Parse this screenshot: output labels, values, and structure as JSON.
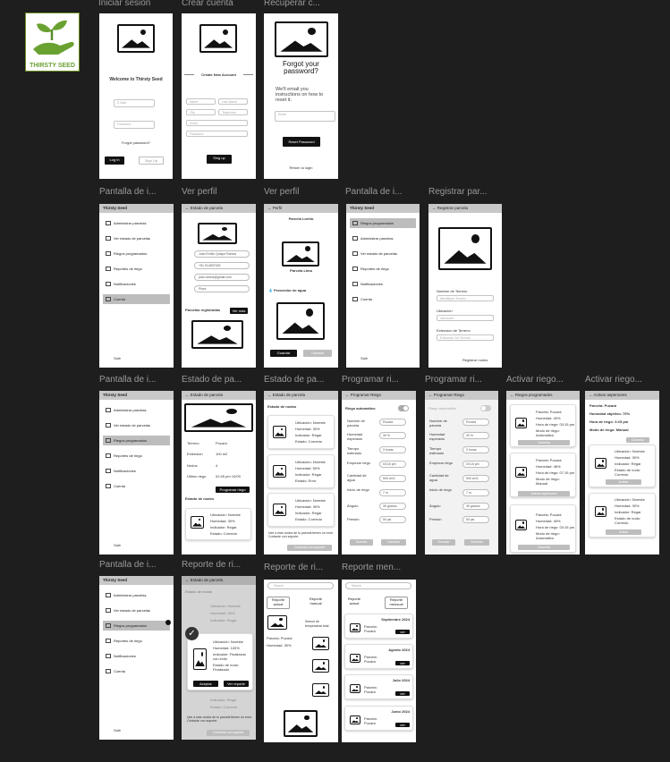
{
  "logo": {
    "text": "THIRSTY SEED"
  },
  "labels": {
    "l1": "Iniciar sesion",
    "l2": "Crear cuenta",
    "l3": "Recuperar c...",
    "l4": "Pantalla de i...",
    "l5": "Ver perfil",
    "l6": "Ver perfil",
    "l7": "Pantalla de i...",
    "l8": "Registrar par...",
    "l9": "Pantalla de i...",
    "l10": "Estado de pa...",
    "l11": "Estado de pa...",
    "l12": "Programar ri...",
    "l13": "Programar ri...",
    "l14": "Activar riego...",
    "l15": "Activar riego...",
    "l16": "Pantalla de i...",
    "l17": "Reporte de ri...",
    "l18": "Reporte de ri...",
    "l19": "Reporte men..."
  },
  "login": {
    "welcome": "Welcome to Thirsty Seed",
    "email": "E-Mail",
    "password": "Password",
    "forgot": "Forgot password?",
    "login": "Log In",
    "signup": "Sign Up"
  },
  "create": {
    "title": "Create New Account",
    "name": "Name",
    "last": "Last Name",
    "city": "City",
    "phone": "Telephone",
    "email": "Email",
    "password": "Password",
    "signup": "Sing up"
  },
  "recover": {
    "title": "Forgot your password?",
    "desc": "We'll email you instructions on how to reset it.",
    "email": "Email",
    "reset": "Reset Password",
    "back": "Return to login"
  },
  "menu": {
    "brand": "Thirsty Seed",
    "items": [
      "Administrar parcelas",
      "Ver estado de parcelas",
      "Riegos programados",
      "Reportes de riego",
      "Notificaciones",
      "Cuenta"
    ],
    "items_b": [
      "Riegos programados",
      "Administrar parcelas",
      "Ver estado de parcelas",
      "Reportes de riego",
      "Notificaciones",
      "Cuenta"
    ],
    "exit": "Salir"
  },
  "profile": {
    "header": "Estado de parcela",
    "name": "Juan Emilio Quispe Ramos",
    "phone": "+51 914837026",
    "email": "juan.ramos@gmail.com",
    "city": "Piura",
    "registered": "Parcelas registradas",
    "see_more": "Ver más"
  },
  "profile_edit": {
    "header": "Perfil",
    "parcel1": "Parcela Loreto",
    "parcel2": "Parcela Lima",
    "provider": "Proveedor de agua",
    "save": "Guardar",
    "cancel": "Cancelar"
  },
  "register": {
    "header": "Registrar parcela",
    "name_label": "Nombre de Terreno",
    "name_ph": "Identifique Terreno",
    "loc_label": "Ubicación",
    "loc_ph": "Ubicación",
    "ext_label": "Extension de Terreno",
    "ext_ph": "Extensión De Terreno",
    "submit": "Registrar nodos"
  },
  "parcel_state": {
    "header": "Estado de parcela",
    "rows": [
      {
        "k": "Terreno",
        "v": "Pucará"
      },
      {
        "k": "Extensión",
        "v": "100 m2"
      },
      {
        "k": "Nodos",
        "v": "4"
      },
      {
        "k": "Último riego",
        "v": "02:45 pm 10/09"
      }
    ],
    "program": "Programar riego",
    "nodes_title": "Estado de nodos",
    "node": {
      "loc": "Ubicación: Noreste",
      "hum": "Humedad: 30%",
      "ind": "Indicador: Regar",
      "state": "Estado: Correcto"
    }
  },
  "nodes": {
    "header": "Estado de parcela",
    "title": "Estado de nodos",
    "items": [
      {
        "loc": "Ubicación: Noreste",
        "hum": "Humedad: 30%",
        "ind": "Indicador: Regar",
        "state": "Estado: Correcto"
      },
      {
        "loc": "Ubicación: Noreste",
        "hum": "Humedad: 50%",
        "ind": "Indicador: Regar",
        "state": "Estado: Error"
      },
      {
        "loc": "Ubicación: Noreste",
        "hum": "Humedad: 30%",
        "ind": "Indicador: Regar",
        "state": "Estado: Correcto"
      }
    ],
    "note": "Use a más nodos de tu parcela tienen un error. Contacte con soporte.",
    "contact": "Contactar con soporte"
  },
  "schedule": {
    "header": "Programar Riego",
    "auto": "Riego automático",
    "fields": [
      {
        "k": "Nombre de parcela",
        "v": "Pucará"
      },
      {
        "k": "Humedad esperada",
        "v": "30 %"
      },
      {
        "k": "Tiempo estimado",
        "v": "3 horas"
      },
      {
        "k": "Empezar riego",
        "v": "03:15 pm"
      },
      {
        "k": "Cantidad de agua",
        "v": "500 cm3"
      },
      {
        "k": "Inicio de riego",
        "v": "7 m"
      },
      {
        "k": "Ángulo",
        "v": "35 grados"
      },
      {
        "k": "Presión",
        "v": "50 psi"
      }
    ],
    "save": "Guardar",
    "cancel": "Cancelar"
  },
  "activate": {
    "header": "Riegos programados",
    "items": [
      {
        "p": "Parcela: Pucará",
        "h": "Humedad: 40%",
        "t": "Hora de riego: 03:15 pm",
        "m": "Modo de riego: Automático",
        "b": "Cancelar"
      },
      {
        "p": "Parcela: Pucará",
        "h": "Humedad: 46%",
        "t": "Hora de riego: 07:15 pm",
        "m": "Modo de riego: Manual",
        "b": "Activar aspersores"
      },
      {
        "p": "Parcela: Pucará",
        "h": "Humedad: 40%",
        "t": "Hora de riego: 03:15 pm",
        "m": "Modo de riego: Automático",
        "b": "Cancelar"
      }
    ]
  },
  "activate2": {
    "header": "Activar aspersores",
    "parcel": "Parcela: Pucará",
    "hum": "Humedad objetivo: 70%",
    "time": "Hora de riego: 3:15 pm",
    "mode": "Modo de riego: Manual",
    "top_btn": "Cancelar",
    "items": [
      {
        "loc": "Ubicación: Noreste",
        "hum": "Humedad: 30%",
        "ind": "Indicador: Regar",
        "state": "Estado de nodo: Correcto",
        "b": "Activar"
      },
      {
        "loc": "Ubicación: Noreste",
        "hum": "Humedad: 30%",
        "ind": "Indicador: Regar",
        "state": "Estado de nodo: Correcto",
        "b": "Activar"
      }
    ]
  },
  "report_modal": {
    "header": "Estado de parcela",
    "loc": "Ubicación: Noreste",
    "hum": "Humedad: 100%",
    "ind": "Indicador: Finalizado con éxito",
    "state": "Estado de nodo: Finalizado",
    "accept": "Aceptar",
    "view": "Ver reporte"
  },
  "report": {
    "search": "Search",
    "tab_actual": "Reporte actual",
    "tab_manual": "Reporte manual",
    "sensor": "Sensor de temperatura total",
    "parcel": "Parcela: Pucará",
    "hum": "Humedad: 30%"
  },
  "monthly": {
    "search": "Search",
    "tab_actual": "Reporte actual",
    "tab_monthly": "Reporte mensual",
    "items": [
      {
        "month": "Septiembre 2024",
        "p": "Parcela: Pucará",
        "b": "ver"
      },
      {
        "month": "Agosto 2024",
        "p": "Parcela: Pucará",
        "b": "ver"
      },
      {
        "month": "Julio 2024",
        "p": "Parcela: Pucará",
        "b": "ver"
      },
      {
        "month": "Junio 2024",
        "p": "Parcela: Pucará",
        "b": "ver"
      }
    ]
  }
}
